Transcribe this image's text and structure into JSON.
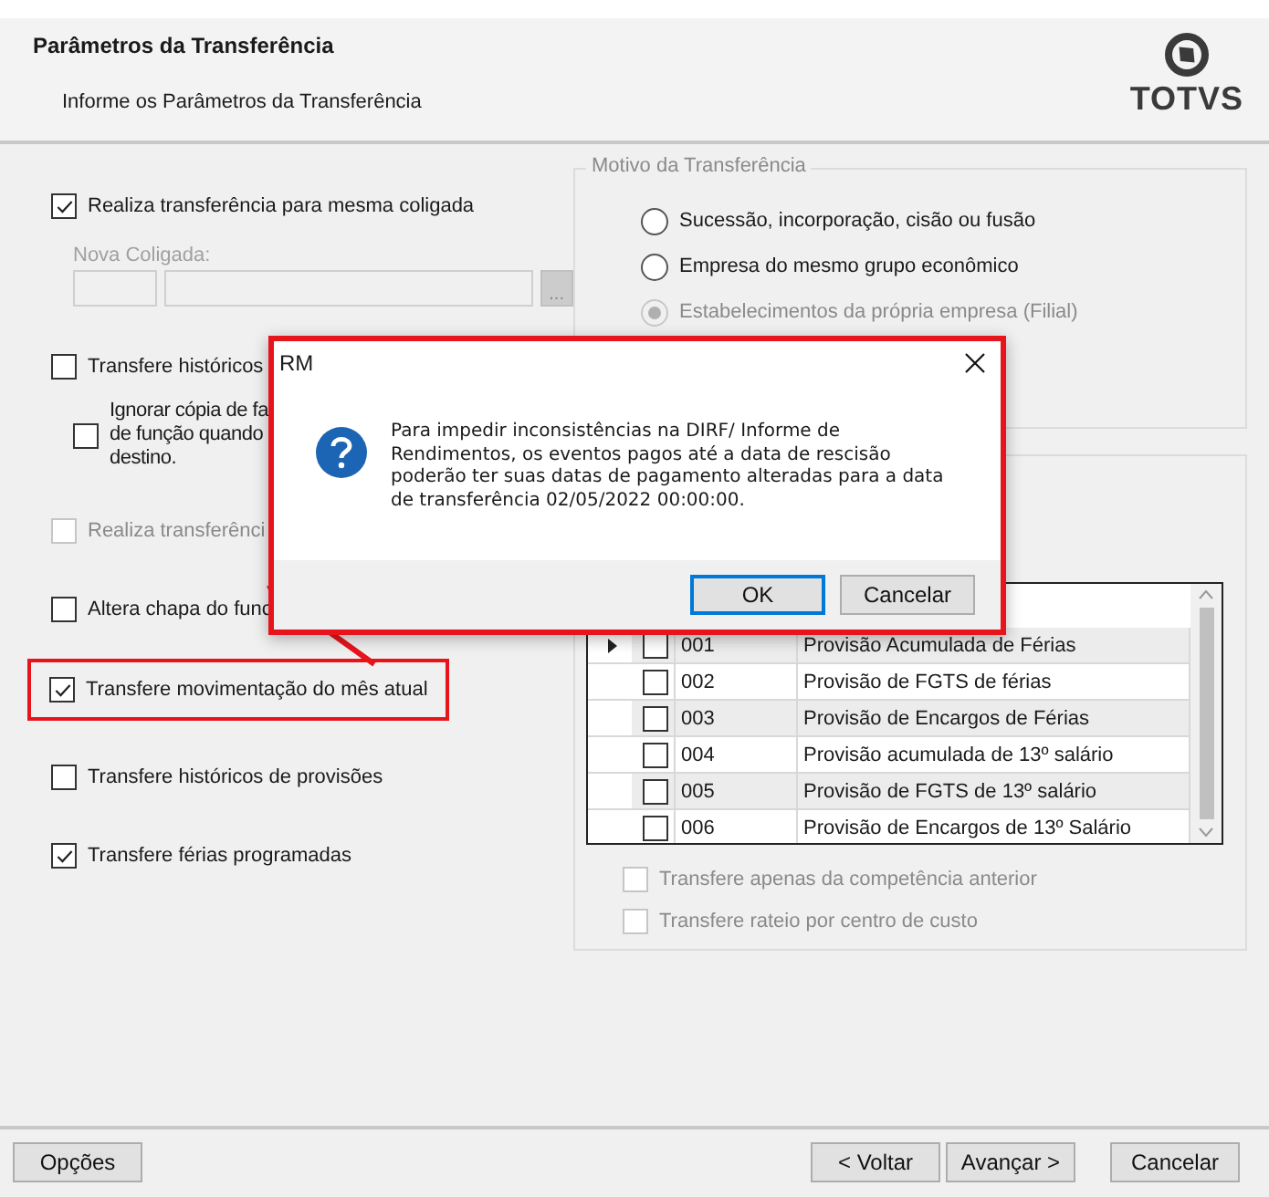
{
  "header": {
    "title": "Parâmetros da Transferência",
    "subtitle": "Informe os Parâmetros da Transferência",
    "logo": "TOTVS"
  },
  "options": [
    {
      "kind": "checkbox",
      "label": "Realiza transferência para mesma coligada",
      "checked": true,
      "disabled": false,
      "highlighted": false
    },
    {
      "kind": "lookup",
      "label": "Nova Coligada:",
      "button": "...",
      "disabled": true
    },
    {
      "kind": "checkbox",
      "label": "Transfere históricos",
      "checked": false,
      "disabled": false,
      "highlighted": false
    },
    {
      "kind": "subcheckbox",
      "label": "Ignorar cópia de fa\nde função quando\ndestino.",
      "checked": false,
      "disabled": false,
      "highlighted": false
    },
    {
      "kind": "checkbox",
      "label": "Realiza transferênci",
      "checked": false,
      "disabled": true,
      "highlighted": false
    },
    {
      "kind": "checkbox",
      "label": "Altera chapa do func",
      "checked": false,
      "disabled": false,
      "highlighted": false
    },
    {
      "kind": "checkbox",
      "label": "Transfere movimentação do mês atual",
      "checked": true,
      "disabled": false,
      "highlighted": true
    },
    {
      "kind": "checkbox",
      "label": "Transfere históricos de provisões",
      "checked": false,
      "disabled": false,
      "highlighted": false
    },
    {
      "kind": "checkbox",
      "label": "Transfere férias programadas",
      "checked": true,
      "disabled": false,
      "highlighted": false
    }
  ],
  "motivo": {
    "title": "Motivo da Transferência",
    "options": [
      {
        "label": "Sucessão, incorporação, cisão ou fusão",
        "selected": false,
        "disabled": false
      },
      {
        "label": "Empresa do mesmo grupo econômico",
        "selected": false,
        "disabled": false
      },
      {
        "label": "Estabelecimentos da própria empresa (Filial)",
        "selected": true,
        "disabled": true
      }
    ]
  },
  "provisions": {
    "rows": [
      {
        "code": "001",
        "name": "Provisão Acumulada de Férias",
        "checked": false,
        "current": true
      },
      {
        "code": "002",
        "name": "Provisão de FGTS de férias",
        "checked": false,
        "current": false
      },
      {
        "code": "003",
        "name": "Provisão de Encargos de Férias",
        "checked": false,
        "current": false
      },
      {
        "code": "004",
        "name": "Provisão acumulada de 13º salário",
        "checked": false,
        "current": false
      },
      {
        "code": "005",
        "name": "Provisão de FGTS de 13º salário",
        "checked": false,
        "current": false
      },
      {
        "code": "006",
        "name": "Provisão de Encargos de 13º Salário",
        "checked": false,
        "current": false
      }
    ],
    "checks": [
      {
        "label": "Transfere apenas da competência anterior",
        "checked": false,
        "disabled": true
      },
      {
        "label": "Transfere rateio por centro de custo",
        "checked": false,
        "disabled": true
      }
    ]
  },
  "footer": {
    "left": "Opções",
    "nav": [
      "< Voltar",
      "Avançar >"
    ],
    "cancel": "Cancelar"
  },
  "dialog": {
    "title": "RM",
    "message": "Para impedir inconsistências na DIRF/ Informe de Rendimentos, os eventos pagos até a data de rescisão poderão ter suas datas de pagamento alteradas para a data de transferência 02/05/2022 00:00:00.",
    "buttons": [
      {
        "label": "OK",
        "default": true
      },
      {
        "label": "Cancelar",
        "default": false
      }
    ]
  }
}
